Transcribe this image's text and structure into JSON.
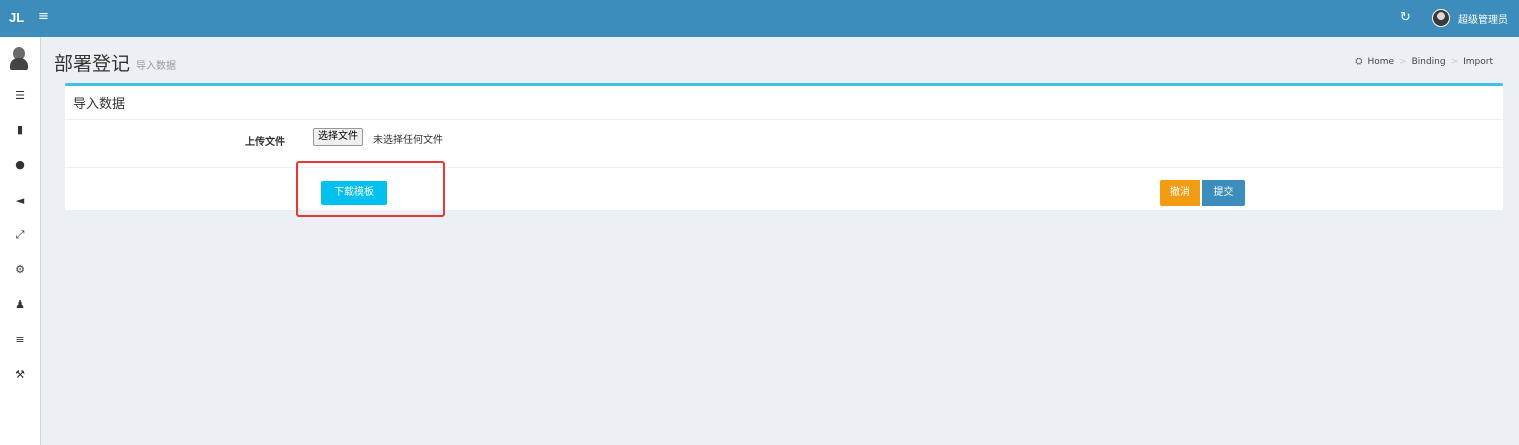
{
  "topbar": {
    "brand": "JL",
    "menu_icon": "≡",
    "refresh_icon": "↻",
    "user_name": "超级管理员"
  },
  "sidebar": {
    "items": [
      {
        "icon": "list-icon",
        "glyph": "☰"
      },
      {
        "icon": "book-icon",
        "glyph": "▮"
      },
      {
        "icon": "user-icon",
        "glyph": "●"
      },
      {
        "icon": "bullhorn-icon",
        "glyph": "◄"
      },
      {
        "icon": "expand-icon",
        "glyph": "⤢"
      },
      {
        "icon": "cogs-icon",
        "glyph": "⚙"
      },
      {
        "icon": "users-icon",
        "glyph": "♟"
      },
      {
        "icon": "bars-icon",
        "glyph": "≡"
      },
      {
        "icon": "wrench-icon",
        "glyph": "⚒"
      }
    ]
  },
  "header": {
    "title": "部署登记",
    "subtitle": "导入数据",
    "breadcrumb": [
      "Home",
      "Binding",
      "Import"
    ],
    "breadcrumb_sep": ">"
  },
  "box": {
    "title": "导入数据",
    "upload_label": "上传文件",
    "choose_file_label": "选择文件",
    "file_status": "未选择任何文件",
    "download_label": "下载模板",
    "cancel_label": "撤消",
    "submit_label": "提交"
  },
  "colors": {
    "topbar": "#3c8dbc",
    "box_accent": "#3cc4e8",
    "download": "#00c0ef",
    "cancel": "#f39c12",
    "submit": "#3c8dbc",
    "highlight": "#e53935"
  }
}
